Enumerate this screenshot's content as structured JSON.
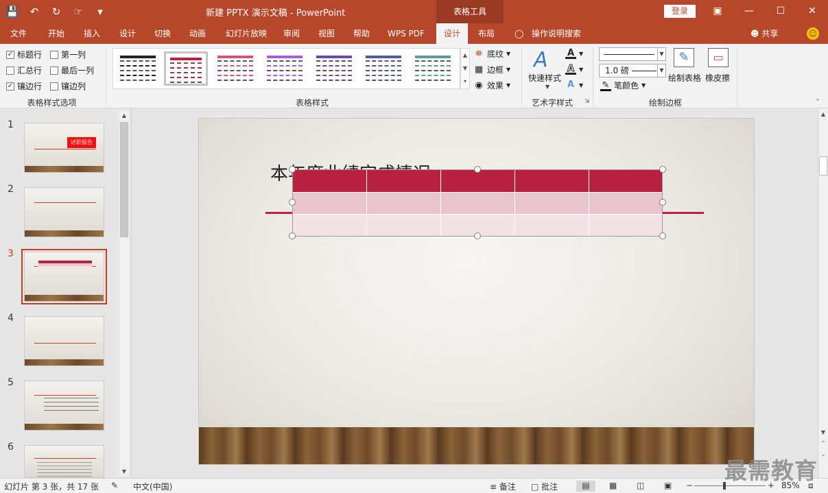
{
  "titlebar": {
    "doc_title": "新建 PPTX 演示文稿 - PowerPoint",
    "context_tab": "表格工具",
    "login": "登录"
  },
  "tabs": [
    "文件",
    "开始",
    "插入",
    "设计",
    "切换",
    "动画",
    "幻灯片放映",
    "审阅",
    "视图",
    "帮助",
    "WPS PDF",
    "设计",
    "布局"
  ],
  "active_tab_index": 11,
  "tell_me": "操作说明搜索",
  "share": "共享",
  "ribbon": {
    "table_style_options": {
      "label": "表格样式选项",
      "checkboxes": [
        {
          "label": "标题行",
          "checked": true
        },
        {
          "label": "第一列",
          "checked": false
        },
        {
          "label": "汇总行",
          "checked": false
        },
        {
          "label": "最后一列",
          "checked": false
        },
        {
          "label": "镶边行",
          "checked": true
        },
        {
          "label": "镶边列",
          "checked": false
        }
      ]
    },
    "table_styles": {
      "label": "表格样式",
      "swatch_colors": [
        "#222222",
        "#b8213f",
        "#d6537a",
        "#a45ee0",
        "#6a4aa8",
        "#4a5d9c",
        "#5c9aa0"
      ],
      "selected_index": 1,
      "shading": "底纹",
      "borders": "边框",
      "effects": "效果"
    },
    "wordart": {
      "label": "艺术字样式",
      "quick_styles": "快速样式"
    },
    "draw_borders": {
      "label": "绘制边框",
      "pen_weight": "1.0 磅",
      "pen_color": "笔颜色",
      "draw_table": "绘制表格",
      "eraser": "橡皮擦"
    }
  },
  "slides": {
    "numbers": [
      "1",
      "2",
      "3",
      "4",
      "5",
      "6"
    ],
    "active_index": 2,
    "slide1_title": "述职报告"
  },
  "main_slide": {
    "title": "本年度业绩完成情况",
    "table_colors": {
      "header": "#b8213f",
      "band1": "#e9c5ce",
      "band2": "#f3e3e7"
    }
  },
  "statusbar": {
    "slide_info": "幻灯片 第 3 张，共 17 张",
    "language": "中文(中国)",
    "notes": "备注",
    "comments": "批注",
    "zoom": "85%"
  },
  "watermark": "最需教育"
}
